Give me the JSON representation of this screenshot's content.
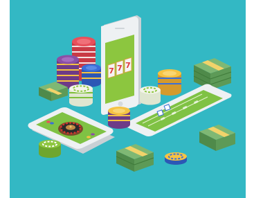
{
  "illustration": {
    "slot_symbols": [
      "7",
      "7",
      "7"
    ],
    "colors": {
      "background": "#33b8c4",
      "felt": "#7fc244",
      "felt_dark": "#69a836",
      "phone_body": "#e9edf0",
      "phone_side": "#c9d0d5",
      "cash": "#5d9a57",
      "cash_band": "#f2d36a",
      "chip_red": "#e8505b",
      "chip_purple": "#8b4fa6",
      "chip_yellow": "#f6c343",
      "chip_blue": "#3a6fd8",
      "chip_green": "#8ec63f",
      "wheel": "#7a4a2a"
    },
    "objects": [
      "phone-with-slot-machine",
      "phone-with-roulette",
      "phone-with-card-table",
      "casino-chip-stacks",
      "cash-bundles",
      "dice"
    ]
  }
}
